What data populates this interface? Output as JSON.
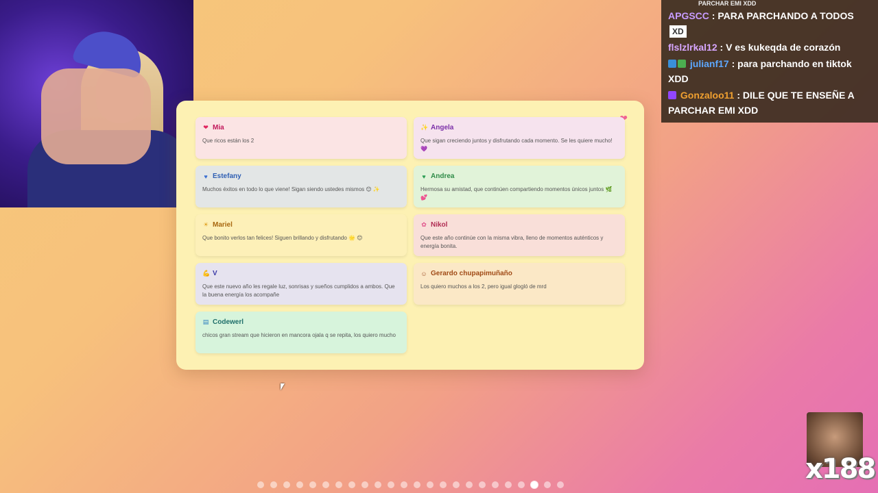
{
  "chat": {
    "top_line": "PARCHAR EMI XDD",
    "messages": [
      {
        "user": "APGSCC",
        "user_color": "#c79cff",
        "text": "PARA PARCHANDO A TODOS",
        "emote": "XD"
      },
      {
        "user": "flslzlrkal12",
        "user_color": "#d7a6ff",
        "text": "V es kukeqda de corazón"
      },
      {
        "user": "julianf17",
        "user_color": "#5da8ff",
        "text": "para parchando en tiktok XDD"
      },
      {
        "user": "Gonzaloo11",
        "user_color": "#f0a030",
        "text": "DILE QUE TE ENSEÑE A PARCHAR EMI XDD"
      }
    ]
  },
  "cards": [
    {
      "icon": "❤",
      "icon_color": "#e0245e",
      "name": "Mia",
      "name_color": "#c2185b",
      "bg": "#fbe4e4",
      "text": "Que ricos están los 2"
    },
    {
      "icon": "✨",
      "icon_color": "#e0a020",
      "name": "Angela",
      "name_color": "#7b2fa8",
      "bg": "#f6e3ee",
      "text": "Que sigan creciendo juntos y disfrutando cada momento. Se les quiere mucho! 💜"
    },
    {
      "icon": "♥",
      "icon_color": "#3b6fd1",
      "name": "Estefany",
      "name_color": "#2f5fb3",
      "bg": "#e3e6e6",
      "text": "Muchos éxitos en todo lo que viene! Sigan siendo ustedes mismos 😊 ✨"
    },
    {
      "icon": "♥",
      "icon_color": "#2e9e55",
      "name": "Andrea",
      "name_color": "#2e8b47",
      "bg": "#e1f3d9",
      "text": "Hermosa su amistad, que continúen compartiendo momentos únicos juntos 🌿 💕"
    },
    {
      "icon": "☀",
      "icon_color": "#e0a020",
      "name": "Mariel",
      "name_color": "#a8670f",
      "bg": "#fdf0b8",
      "text": "Que bonito verlos tan felices! Siguen brillando y disfrutando 🌟 😊"
    },
    {
      "icon": "✿",
      "icon_color": "#e0508a",
      "name": "Nikol",
      "name_color": "#b02c52",
      "bg": "#f9dfd9",
      "text": "Que este año continúe con la misma vibra, lleno de momentos auténticos y energía bonita."
    },
    {
      "icon": "💪",
      "icon_color": "#e0a020",
      "name": "V",
      "name_color": "#3a3aa8",
      "bg": "#e6e3ef",
      "text": "Que este nuevo año les regale luz, sonrisas y sueños cumplidos a ambos. Que la buena energía los acompañe"
    },
    {
      "icon": "☺",
      "icon_color": "#a0522d",
      "name": "Gerardo chupapimuñaño",
      "name_color": "#a04a16",
      "bg": "#fbe8c6",
      "text": "Los quiero muchos a los 2, pero igual glogló de mrd"
    },
    {
      "icon": "▤",
      "icon_color": "#2f7fbf",
      "name": "Codewerl",
      "name_color": "#1f6f6a",
      "bg": "#d7f4dc",
      "text": "chicos gran stream que hicieron en mancora ojala q se repita, los quiero mucho"
    }
  ],
  "sticker": {
    "count": "x188"
  },
  "pagination": {
    "total": 24,
    "active_index": 21
  }
}
